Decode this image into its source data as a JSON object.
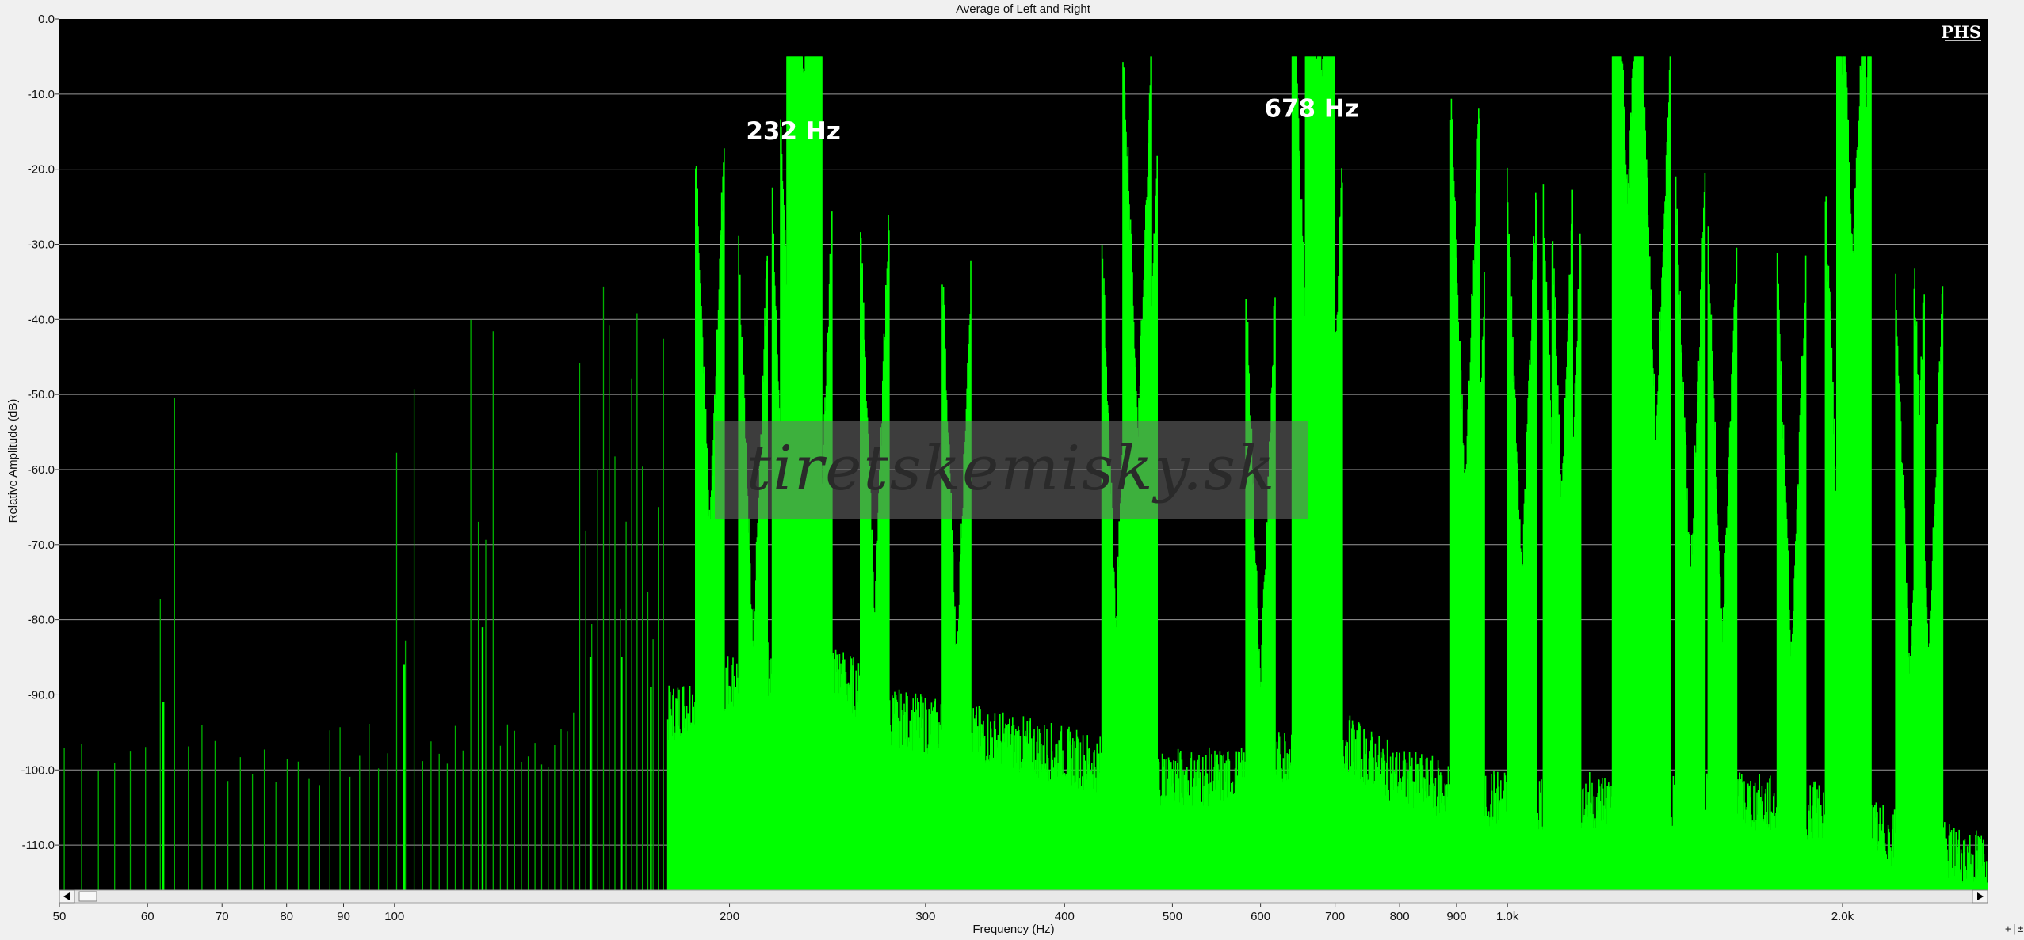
{
  "colors": {
    "plot_background": "#000000",
    "spectrum": "#00ff00",
    "spectrum_low": "#00b300",
    "grid": "#9a9a9a",
    "frame": "#f0f0f0"
  },
  "logo": "PHS",
  "watermark": "tiretskemisky.sk",
  "annotations": [
    {
      "text": "232 Hz",
      "freq": 232
    },
    {
      "text": "678 Hz",
      "freq": 678
    }
  ],
  "scrollbar": {
    "left_arrow_icon": "arrow-left-icon",
    "right_arrow_icon": "arrow-right-icon"
  },
  "chart_data": {
    "type": "line",
    "title": "Average of Left and Right",
    "xlabel": "Frequency (Hz)",
    "ylabel": "Relative Amplitude (dB)",
    "x_scale": "log",
    "xlim": [
      50,
      2700
    ],
    "ylim": [
      -116,
      0
    ],
    "grid": true,
    "yticks": [
      0,
      -10,
      -20,
      -30,
      -40,
      -50,
      -60,
      -70,
      -80,
      -90,
      -100,
      -110
    ],
    "ytick_labels": [
      "0.0",
      "-10.0",
      "-20.0",
      "-30.0",
      "-40.0",
      "-50.0",
      "-60.0",
      "-70.0",
      "-80.0",
      "-90.0",
      "-100.0",
      "-110.0"
    ],
    "xticks": [
      50,
      60,
      70,
      80,
      90,
      100,
      200,
      300,
      400,
      500,
      600,
      700,
      800,
      900,
      1000,
      2000
    ],
    "xtick_labels": [
      "50",
      "60",
      "70",
      "80",
      "90",
      "100",
      "200",
      "300",
      "400",
      "500",
      "600",
      "700",
      "800",
      "900",
      "1.0k",
      "2.0k"
    ],
    "series": [
      {
        "noise_floor": [
          [
            50,
            -97
          ],
          [
            60,
            -97
          ],
          [
            62,
            -93
          ],
          [
            70,
            -98
          ],
          [
            80,
            -99
          ],
          [
            90,
            -98
          ],
          [
            100,
            -97
          ],
          [
            120,
            -96
          ],
          [
            150,
            -96
          ],
          [
            175,
            -93
          ],
          [
            190,
            -90
          ],
          [
            200,
            -88
          ],
          [
            220,
            -86
          ],
          [
            232,
            -84
          ],
          [
            245,
            -86
          ],
          [
            280,
            -93
          ],
          [
            350,
            -96
          ],
          [
            400,
            -98
          ],
          [
            450,
            -100
          ],
          [
            500,
            -101
          ],
          [
            600,
            -101
          ],
          [
            650,
            -96
          ],
          [
            678,
            -82
          ],
          [
            710,
            -96
          ],
          [
            800,
            -101
          ],
          [
            900,
            -103
          ],
          [
            1000,
            -104
          ],
          [
            1200,
            -104
          ],
          [
            1400,
            -104
          ],
          [
            1600,
            -104
          ],
          [
            1800,
            -105
          ],
          [
            2000,
            -106
          ],
          [
            2300,
            -110
          ],
          [
            2700,
            -112
          ]
        ],
        "peaks": [
          [
            62,
            -91
          ],
          [
            102,
            -86
          ],
          [
            120,
            -81
          ],
          [
            150,
            -85
          ],
          [
            160,
            -85
          ],
          [
            170,
            -89
          ],
          [
            192,
            -69
          ],
          [
            210,
            -84
          ],
          [
            225,
            -77
          ],
          [
            229,
            -66
          ],
          [
            232,
            -17.5
          ],
          [
            235,
            -25
          ],
          [
            240,
            -79
          ],
          [
            270,
            -79
          ],
          [
            320,
            -86
          ],
          [
            445,
            -81
          ],
          [
            465,
            -56.5
          ],
          [
            470,
            -73
          ],
          [
            600,
            -90
          ],
          [
            660,
            -44.5
          ],
          [
            678,
            -14.5
          ],
          [
            690,
            -72
          ],
          [
            916,
            -63.5
          ],
          [
            925,
            -90
          ],
          [
            1030,
            -76
          ],
          [
            1110,
            -78
          ],
          [
            1130,
            -81
          ],
          [
            1280,
            -30
          ],
          [
            1285,
            -28.5
          ],
          [
            1360,
            -56
          ],
          [
            1460,
            -76
          ],
          [
            1560,
            -83
          ],
          [
            1800,
            -86
          ],
          [
            1990,
            -77
          ],
          [
            2035,
            -41
          ],
          [
            2060,
            -46.5
          ],
          [
            2300,
            -88
          ],
          [
            2390,
            -87
          ]
        ]
      }
    ]
  }
}
